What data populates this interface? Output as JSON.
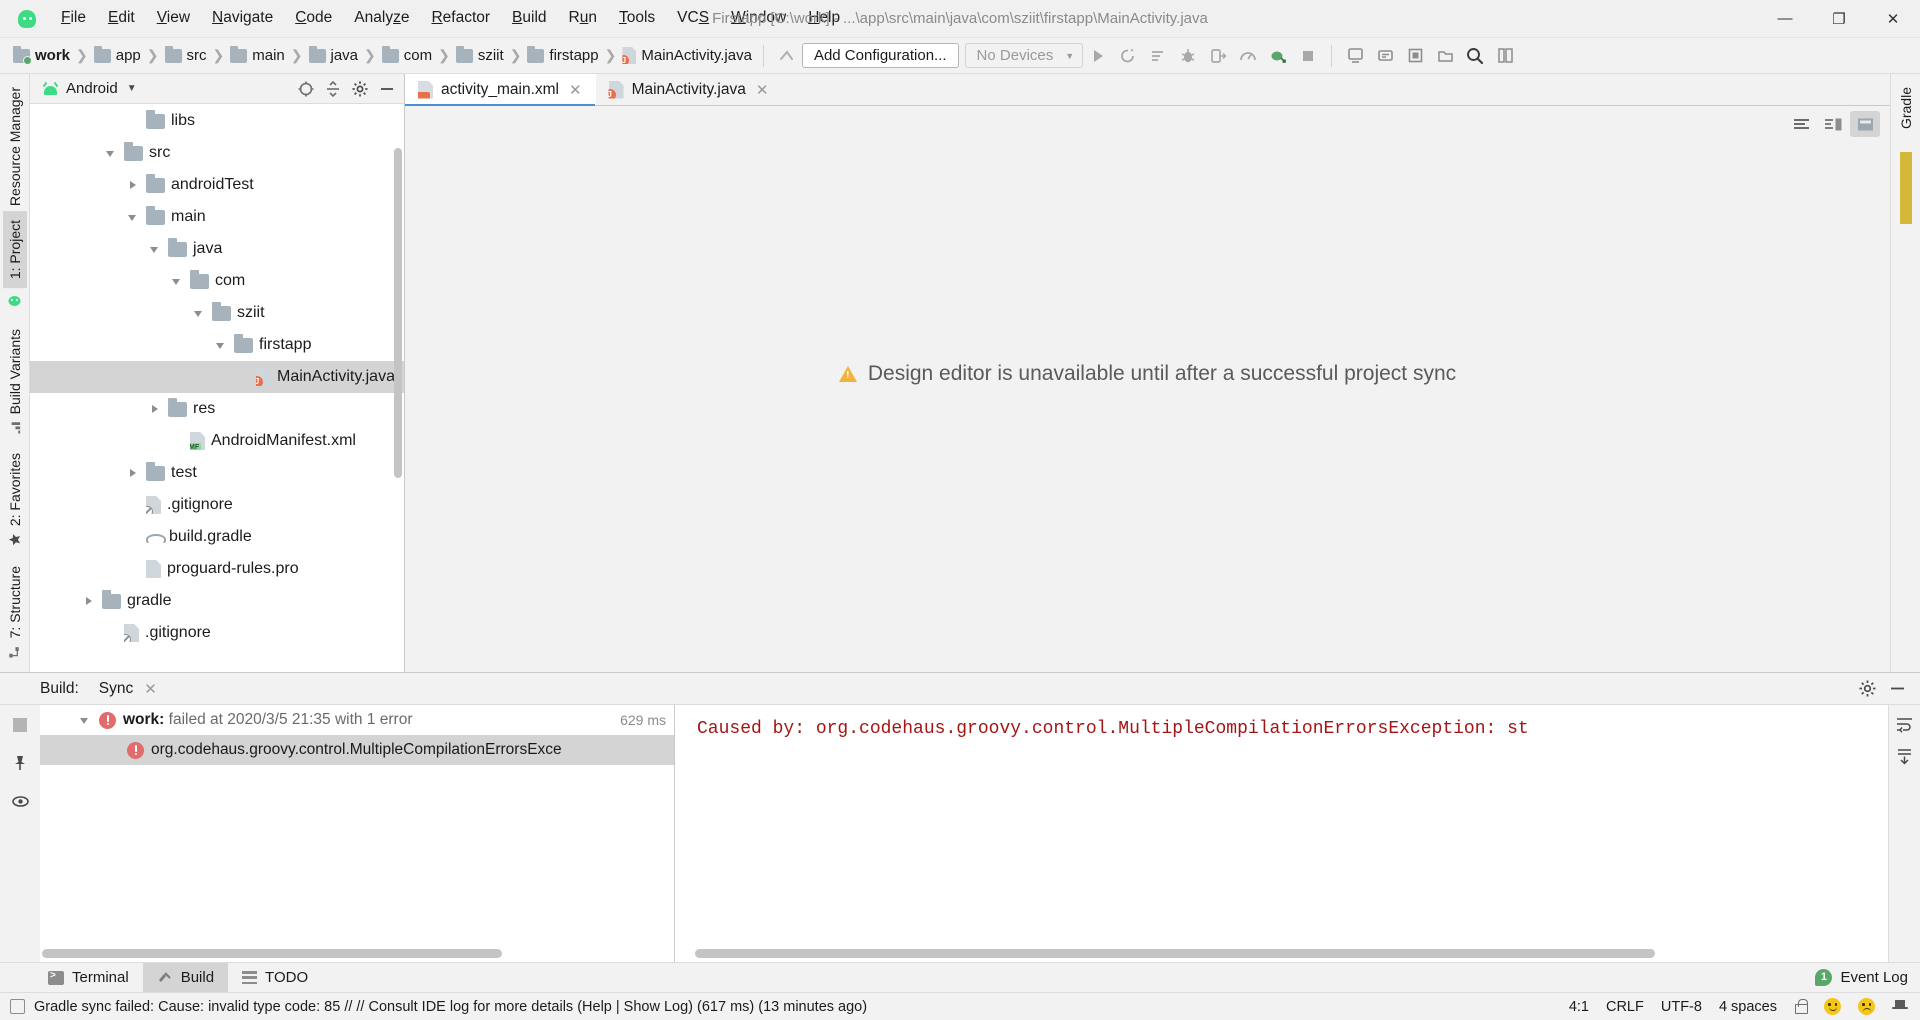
{
  "window": {
    "app_icon": "android-studio-icon",
    "title": "Firstapp [C:\\work] - ...\\app\\src\\main\\java\\com\\sziit\\firstapp\\MainActivity.java",
    "minimize": "—",
    "maximize": "❐",
    "close": "✕"
  },
  "menu": [
    {
      "label": "File",
      "mnemonic": "F"
    },
    {
      "label": "Edit",
      "mnemonic": "E"
    },
    {
      "label": "View",
      "mnemonic": "V"
    },
    {
      "label": "Navigate",
      "mnemonic": "N"
    },
    {
      "label": "Code",
      "mnemonic": "C"
    },
    {
      "label": "Analyze",
      "mnemonic": "z"
    },
    {
      "label": "Refactor",
      "mnemonic": "R"
    },
    {
      "label": "Build",
      "mnemonic": "B"
    },
    {
      "label": "Run",
      "mnemonic": "u"
    },
    {
      "label": "Tools",
      "mnemonic": "T"
    },
    {
      "label": "VCS",
      "mnemonic": "S"
    },
    {
      "label": "Window",
      "mnemonic": "W"
    },
    {
      "label": "Help",
      "mnemonic": "H"
    }
  ],
  "breadcrumb": [
    {
      "label": "work",
      "icon": "folder-module-icon",
      "bold": true
    },
    {
      "label": "app",
      "icon": "folder-icon",
      "bold": false
    },
    {
      "label": "src",
      "icon": "folder-icon",
      "bold": false
    },
    {
      "label": "main",
      "icon": "folder-icon",
      "bold": false
    },
    {
      "label": "java",
      "icon": "folder-icon",
      "bold": false
    },
    {
      "label": "com",
      "icon": "folder-icon",
      "bold": false
    },
    {
      "label": "sziit",
      "icon": "folder-icon",
      "bold": false
    },
    {
      "label": "firstapp",
      "icon": "folder-icon",
      "bold": false
    },
    {
      "label": "MainActivity.java",
      "icon": "java-file-icon",
      "bold": false
    }
  ],
  "toolbar": {
    "run_config_label": "Add Configuration...",
    "device_label": "No Devices",
    "icons": [
      "run-icon",
      "rerun-icon",
      "apply-changes-icon",
      "debug-icon",
      "attach-debugger-icon",
      "profiler-icon",
      "sync-gradle-icon",
      "stop-icon",
      "avd-manager-icon",
      "sdk-manager-icon",
      "layout-inspector-icon",
      "device-file-explorer-icon",
      "project-structure-icon",
      "search-icon"
    ]
  },
  "left_rail": {
    "top": [
      {
        "label": "Resource Manager",
        "icon": "resource-manager-icon",
        "active": false
      },
      {
        "label": "1: Project",
        "icon": "project-icon",
        "active": true
      }
    ],
    "bottom": [
      {
        "label": "Build Variants",
        "icon": "build-variants-icon",
        "active": false
      },
      {
        "label": "2: Favorites",
        "icon": "favorites-icon",
        "active": false
      },
      {
        "label": "7: Structure",
        "icon": "structure-icon",
        "active": false
      }
    ]
  },
  "project_panel": {
    "view_label": "Android",
    "view_icon": "android-head-icon",
    "actions": [
      "target-icon",
      "collapse-all-icon",
      "settings-icon",
      "hide-icon"
    ],
    "tree": [
      {
        "label": "libs",
        "icon": "folder-icon",
        "indent": 4,
        "arrow": "none",
        "selected": false
      },
      {
        "label": "src",
        "icon": "folder-icon",
        "indent": 3,
        "arrow": "open",
        "selected": false
      },
      {
        "label": "androidTest",
        "icon": "folder-icon",
        "indent": 4,
        "arrow": "closed",
        "selected": false
      },
      {
        "label": "main",
        "icon": "folder-icon",
        "indent": 4,
        "arrow": "open",
        "selected": false
      },
      {
        "label": "java",
        "icon": "folder-icon",
        "indent": 5,
        "arrow": "open",
        "selected": false
      },
      {
        "label": "com",
        "icon": "folder-icon",
        "indent": 6,
        "arrow": "open",
        "selected": false
      },
      {
        "label": "sziit",
        "icon": "folder-icon",
        "indent": 7,
        "arrow": "open",
        "selected": false
      },
      {
        "label": "firstapp",
        "icon": "folder-icon",
        "indent": 8,
        "arrow": "open",
        "selected": false
      },
      {
        "label": "MainActivity.java",
        "icon": "java-file-icon",
        "indent": 9,
        "arrow": "none",
        "selected": true
      },
      {
        "label": "res",
        "icon": "folder-icon",
        "indent": 5,
        "arrow": "closed",
        "selected": false
      },
      {
        "label": "AndroidManifest.xml",
        "icon": "manifest-file-icon",
        "indent": 6,
        "arrow": "none",
        "selected": false
      },
      {
        "label": "test",
        "icon": "folder-icon",
        "indent": 4,
        "arrow": "closed",
        "selected": false
      },
      {
        "label": ".gitignore",
        "icon": "ignored-file-icon",
        "indent": 4,
        "arrow": "none",
        "selected": false
      },
      {
        "label": "build.gradle",
        "icon": "gradle-file-icon",
        "indent": 4,
        "arrow": "none",
        "selected": false
      },
      {
        "label": "proguard-rules.pro",
        "icon": "text-file-icon",
        "indent": 4,
        "arrow": "none",
        "selected": false
      },
      {
        "label": "gradle",
        "icon": "folder-icon",
        "indent": 2,
        "arrow": "closed",
        "selected": false
      },
      {
        "label": ".gitignore",
        "icon": "ignored-file-icon",
        "indent": 3,
        "arrow": "none",
        "selected": false
      }
    ]
  },
  "editor": {
    "tabs": [
      {
        "label": "activity_main.xml",
        "icon": "xml-layout-icon",
        "active": true,
        "close": "✕"
      },
      {
        "label": "MainActivity.java",
        "icon": "java-file-icon",
        "active": false,
        "close": "✕"
      }
    ],
    "design_message": "Design editor is unavailable until after a successful project sync",
    "mode_buttons": [
      "code-view-icon",
      "split-view-icon",
      "design-view-icon"
    ],
    "active_mode": "design-view-icon"
  },
  "right_rail": {
    "items": [
      {
        "label": "Gradle",
        "icon": "gradle-icon"
      }
    ]
  },
  "build_window": {
    "title": "Build:",
    "tab_label": "Sync",
    "tab_close": "✕",
    "header_actions": [
      "settings-icon",
      "hide-icon"
    ],
    "gutter_actions": [
      "stop-icon",
      "pin-icon",
      "eye-icon"
    ],
    "tree": [
      {
        "prefix": "work:",
        "text": " failed at 2020/3/5 21:35 with 1 error",
        "duration": "629 ms",
        "icon": "error-icon",
        "arrow": "open",
        "selected": false,
        "indent": 1
      },
      {
        "prefix": "",
        "text": "org.codehaus.groovy.control.MultipleCompilationErrorsExce",
        "duration": "",
        "icon": "error-icon",
        "arrow": "none",
        "selected": true,
        "indent": 2
      }
    ],
    "console_text": "Caused by: org.codehaus.groovy.control.MultipleCompilationErrorsException: st",
    "console_actions": [
      "wrap-text-icon",
      "scroll-to-end-icon"
    ]
  },
  "bottom_toolbar": {
    "items": [
      {
        "label": "Terminal",
        "icon": "terminal-icon",
        "active": false
      },
      {
        "label": "Build",
        "icon": "hammer-icon",
        "active": true
      },
      {
        "label": "TODO",
        "icon": "todo-list-icon",
        "active": false
      }
    ],
    "event_log": {
      "label": "Event Log",
      "count": "1",
      "icon": "event-log-icon"
    }
  },
  "status_bar": {
    "icon": "status-message-icon",
    "message": "Gradle sync failed: Cause: invalid type code: 85 // // Consult IDE log for more details (Help | Show Log) (617 ms) (13 minutes ago)",
    "caret_position": "4:1",
    "line_separator": "CRLF",
    "encoding": "UTF-8",
    "indent": "4 spaces",
    "icons": [
      "lock-icon",
      "happy-face-icon",
      "sad-face-icon",
      "hat-icon"
    ]
  },
  "colors": {
    "accent_blue": "#4a90d9",
    "error_red": "#a31515",
    "error_icon_red": "#e06c6c",
    "android_green": "#3ddc84",
    "warning_amber": "#f5b13d",
    "selection_gray": "#d4d4d4"
  }
}
